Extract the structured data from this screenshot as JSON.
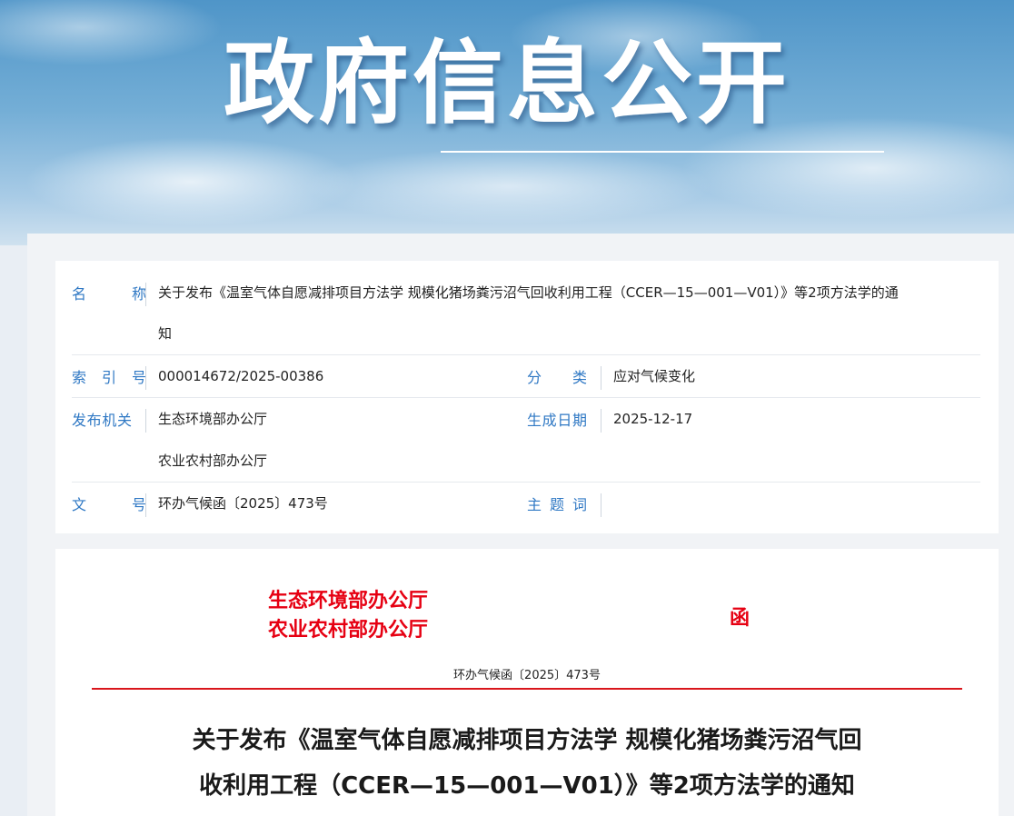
{
  "banner": {
    "title": "政府信息公开"
  },
  "meta": {
    "name_label": "名　称",
    "name_value_line1": "关于发布《温室气体自愿减排项目方法学 规模化猪场粪污沼气回收利用工程（CCER—15—001—V01）》等2项方法学的通",
    "name_value_line2": "知",
    "index_label": "索引号",
    "index_value": "000014672/2025-00386",
    "category_label": "分　类",
    "category_value": "应对气候变化",
    "issuer_label": "发布机关",
    "issuer_value_1": "生态环境部办公厅",
    "issuer_value_2": "农业农村部办公厅",
    "date_label": "生成日期",
    "date_value": "2025-12-17",
    "docno_label": "文　号",
    "docno_value": "环办气候函〔2025〕473号",
    "subject_label": "主题词",
    "subject_value": ""
  },
  "document": {
    "issuer_line1": "生态环境部办公厅",
    "issuer_line2": "农业农村部办公厅",
    "doc_type": "函",
    "doc_number": "环办气候函〔2025〕473号",
    "title_line1": "关于发布《温室气体自愿减排项目方法学 规模化猪场粪污沼气回",
    "title_line2": "收利用工程（CCER—15—001—V01）》等2项方法学的通知"
  },
  "colors": {
    "label_blue": "#2f78c4",
    "header_red": "#e60012"
  }
}
